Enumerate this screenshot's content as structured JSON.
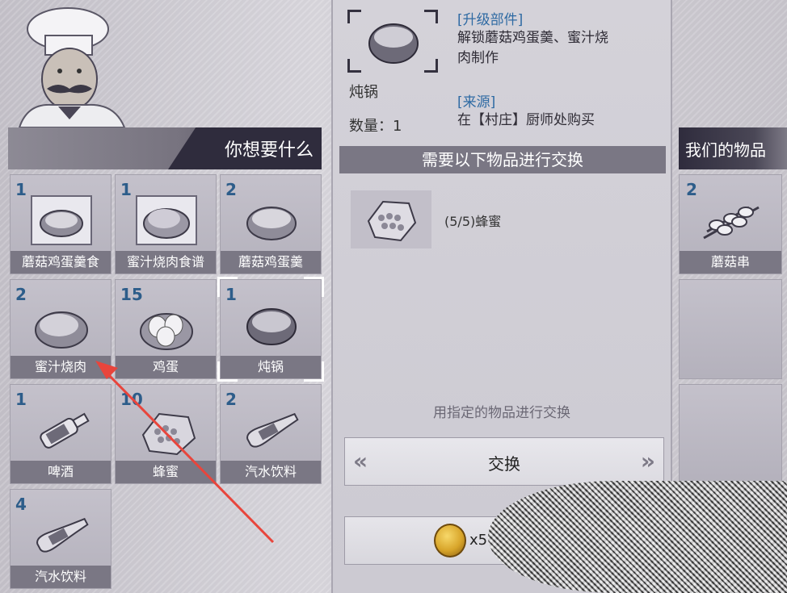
{
  "left": {
    "title": "你想要什么",
    "items": [
      {
        "count": "1",
        "label": "蘑菇鸡蛋羹食",
        "icon": "recipe-bowl-icon"
      },
      {
        "count": "1",
        "label": "蜜汁烧肉食谱",
        "icon": "recipe-meat-icon"
      },
      {
        "count": "2",
        "label": "蘑菇鸡蛋羹",
        "icon": "soup-bowl-icon"
      },
      {
        "count": "2",
        "label": "蜜汁烧肉",
        "icon": "roast-meat-icon"
      },
      {
        "count": "15",
        "label": "鸡蛋",
        "icon": "eggs-icon"
      },
      {
        "count": "1",
        "label": "炖锅",
        "icon": "pot-icon"
      },
      {
        "count": "1",
        "label": "啤酒",
        "icon": "beer-bottle-icon"
      },
      {
        "count": "10",
        "label": "蜂蜜",
        "icon": "honeycomb-icon"
      },
      {
        "count": "2",
        "label": "汽水饮料",
        "icon": "soda-bottle-icon"
      },
      {
        "count": "4",
        "label": "汽水饮料",
        "icon": "soda-bottle-icon"
      }
    ]
  },
  "detail": {
    "name": "炖锅",
    "quantity": "数量：1",
    "upgrade_heading": "[升级部件]",
    "upgrade_line1": "解锁蘑菇鸡蛋羹、蜜汁烧",
    "upgrade_line2": "肉制作",
    "source_heading": "[来源]",
    "source_text": "在【村庄】厨师处购买",
    "exchange_heading": "需要以下物品进行交换",
    "requirement": "(5/5)蜂蜜",
    "hint": "用指定的物品进行交换",
    "swap_label": "交换",
    "swap_left_arrow": "«",
    "swap_right_arrow": "»",
    "coin_count": "x5"
  },
  "right": {
    "title": "我们的物品",
    "items": [
      {
        "count": "2",
        "label": "蘑菇串",
        "icon": "mushroom-skewer-icon"
      }
    ]
  },
  "colors": {
    "accent_blue": "#2e6aa3",
    "header_dark": "#2f2c3d",
    "label_bar": "#7a7784",
    "arrow_red": "#e8453c"
  }
}
